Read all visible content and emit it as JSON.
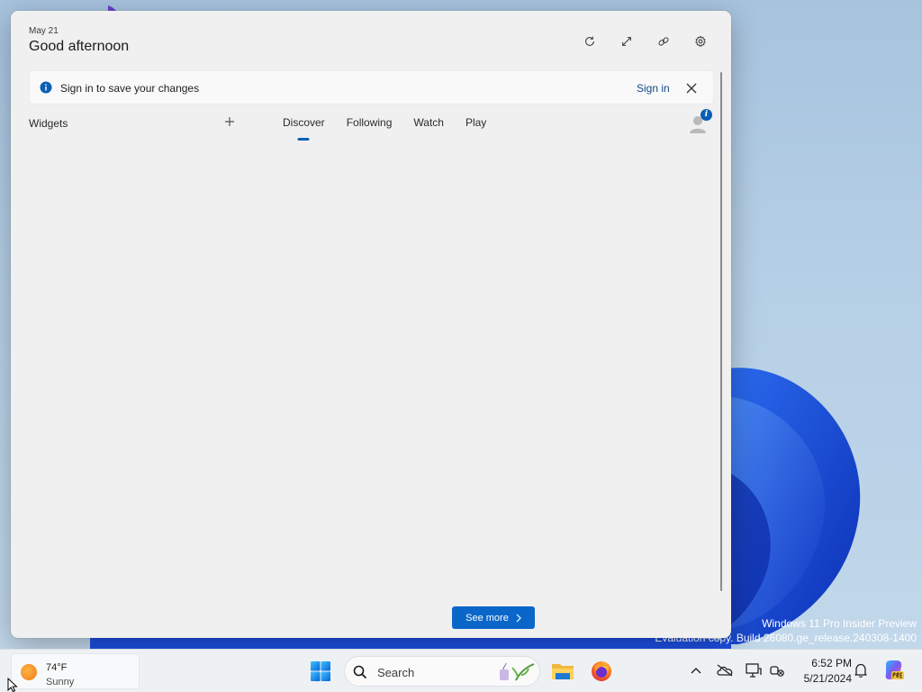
{
  "panel": {
    "date": "May 21",
    "greeting": "Good afternoon",
    "header_icons": [
      "refresh-icon",
      "expand-icon",
      "link-icon",
      "gear-icon"
    ],
    "signin_banner": {
      "message": "Sign in to save your changes",
      "link_label": "Sign in",
      "info_icon": "info-icon",
      "close_icon": "close-icon"
    },
    "widgets_label": "Widgets",
    "add_icon": "plus-icon",
    "tabs": [
      {
        "label": "Discover",
        "active": true
      },
      {
        "label": "Following",
        "active": false
      },
      {
        "label": "Watch",
        "active": false
      },
      {
        "label": "Play",
        "active": false
      }
    ],
    "avatar_badge": "i",
    "see_more_label": "See more"
  },
  "watermark": {
    "line1": "Windows 11 Pro Insider Preview",
    "line2": "Evaluation copy. Build 26080.ge_release.240308-1400"
  },
  "taskbar": {
    "weather": {
      "temp": "74°F",
      "condition": "Sunny"
    },
    "search_placeholder": "Search",
    "apps": [
      "start-icon",
      "file-explorer-icon",
      "firefox-icon"
    ],
    "tray_icons": [
      "chevron-up-icon",
      "onedrive-icon",
      "display-icon",
      "network-icon",
      "bell-icon",
      "copilot-icon"
    ],
    "clock": {
      "time": "6:52 PM",
      "date": "5/21/2024"
    }
  },
  "colors": {
    "accent": "#0a67c9",
    "panel_bg": "#f0f0f0",
    "taskbar_bg": "#eef1f4",
    "wallpaper_bloom": "#1a48d8"
  }
}
